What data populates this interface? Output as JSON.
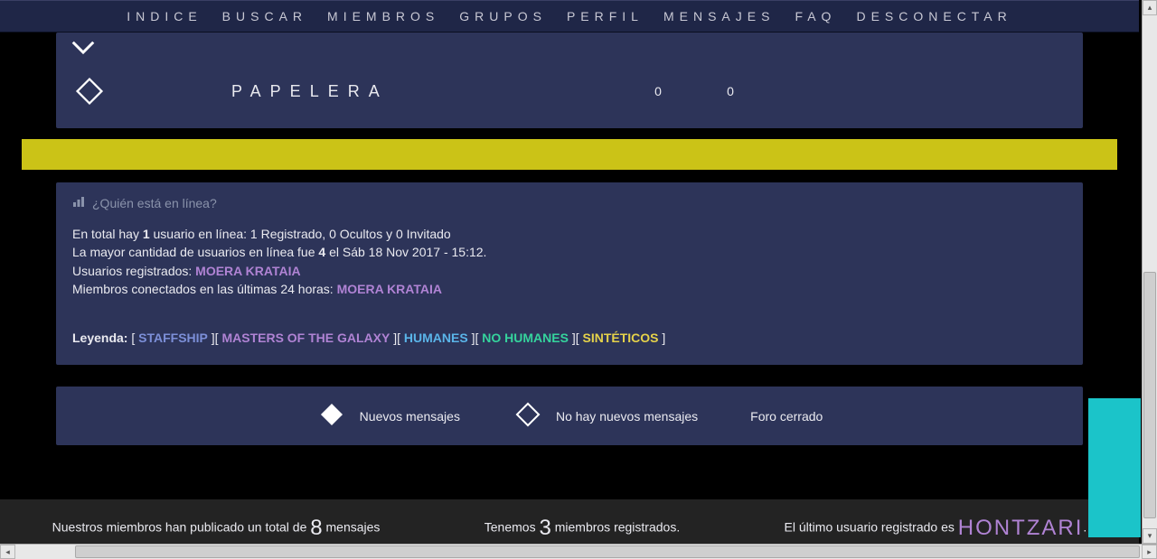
{
  "nav": {
    "items": [
      {
        "label": "INDICE"
      },
      {
        "label": "BUSCAR"
      },
      {
        "label": "MIEMBROS"
      },
      {
        "label": "GRUPOS"
      },
      {
        "label": "PERFIL"
      },
      {
        "label": "MENSAJES"
      },
      {
        "label": "FAQ"
      },
      {
        "label": "DESCONECTAR"
      }
    ]
  },
  "forum": {
    "papelera": {
      "name": "PAPELERA",
      "topics": "0",
      "posts": "0"
    }
  },
  "online": {
    "title": "¿Quién está en línea?",
    "line1_pre": "En total hay ",
    "line1_count": "1",
    "line1_post": " usuario en línea: 1 Registrado, 0 Ocultos y 0 Invitado",
    "line2_pre": "La mayor cantidad de usuarios en línea fue ",
    "line2_count": "4",
    "line2_post": " el Sáb 18 Nov 2017 - 15:12.",
    "line3_pre": "Usuarios registrados: ",
    "line3_user": "MOERA KRATAIA",
    "line4_pre": "Miembros conectados en las últimas 24 horas: ",
    "line4_user": "MOERA KRATAIA"
  },
  "legend": {
    "label": "Leyenda:",
    "groups": {
      "staff": "STAFFSHIP",
      "masters": "MASTERS OF THE GALAXY",
      "humanes": "HUMANES",
      "nohumanes": "NO HUMANES",
      "sinteticos": "SINTÉTICOS"
    }
  },
  "legend_icons": {
    "new": "Nuevos mensajes",
    "nonew": "No hay nuevos mensajes",
    "closed": "Foro cerrado"
  },
  "footer": {
    "posts_pre": "Nuestros miembros han publicado un total de ",
    "posts_count": "8",
    "posts_post": " mensajes",
    "members_pre": "Tenemos ",
    "members_count": "3",
    "members_post": " miembros registrados.",
    "lastuser_pre": "El último usuario registrado es ",
    "lastuser_name": "HONTZARI",
    "lastuser_post": "."
  }
}
